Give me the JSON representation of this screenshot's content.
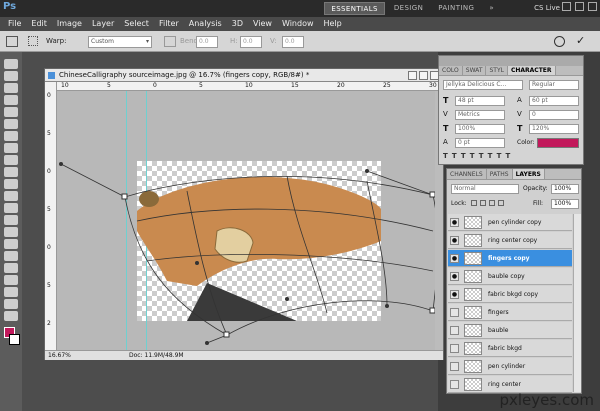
{
  "app": {
    "logo": "Ps"
  },
  "workspace_buttons": [
    {
      "label": "ESSENTIALS",
      "active": true
    },
    {
      "label": "DESIGN",
      "active": false
    },
    {
      "label": "PAINTING",
      "active": false
    },
    {
      "label": "»",
      "active": false
    }
  ],
  "cs_live": "CS Live",
  "menu": [
    "File",
    "Edit",
    "Image",
    "Layer",
    "Select",
    "Filter",
    "Analysis",
    "3D",
    "View",
    "Window",
    "Help"
  ],
  "options": {
    "warp_label": "Warp:",
    "warp_value": "Custom",
    "bend_label": "Bend:",
    "bend_value": "0.0",
    "h_label": "H:",
    "h_value": "0.0",
    "v_label": "V:",
    "v_value": "0.0"
  },
  "document": {
    "title": "ChineseCalligraphy sourceimage.jpg @ 16.7% (fingers copy, RGB/8#) *",
    "zoom": "16.67%",
    "doc_size": "Doc: 11.9M/48.9M",
    "ruler_top": [
      "10",
      "5",
      "0",
      "5",
      "10",
      "15",
      "20",
      "25",
      "30"
    ],
    "ruler_left": [
      "0",
      "5",
      "0",
      "5",
      "0",
      "5",
      "2"
    ]
  },
  "character_panel": {
    "tabs": [
      {
        "label": "COLO",
        "active": false
      },
      {
        "label": "SWAT",
        "active": false
      },
      {
        "label": "STYL",
        "active": false
      },
      {
        "label": "CHARACTER",
        "active": true
      }
    ],
    "font_family": "Jellyka Delicious C...",
    "font_style": "Regular",
    "font_size": "48 pt",
    "leading": "60 pt",
    "kerning": "Metrics",
    "tracking": "0",
    "vscale": "100%",
    "hscale": "120%",
    "baseline": "0 pt",
    "color_label": "Color:",
    "color": "#c2185b"
  },
  "layers_panel": {
    "tabs": [
      {
        "label": "CHANNELS",
        "active": false
      },
      {
        "label": "PATHS",
        "active": false
      },
      {
        "label": "LAYERS",
        "active": true
      }
    ],
    "blend_mode": "Normal",
    "opacity_label": "Opacity:",
    "opacity": "100%",
    "lock_label": "Lock:",
    "fill_label": "Fill:",
    "fill": "100%",
    "layers": [
      {
        "name": "pen cylinder copy",
        "visible": true,
        "selected": false
      },
      {
        "name": "ring center copy",
        "visible": true,
        "selected": false
      },
      {
        "name": "fingers copy",
        "visible": true,
        "selected": true
      },
      {
        "name": "bauble copy",
        "visible": true,
        "selected": false
      },
      {
        "name": "fabric bkgd copy",
        "visible": true,
        "selected": false
      },
      {
        "name": "fingers",
        "visible": false,
        "selected": false
      },
      {
        "name": "bauble",
        "visible": false,
        "selected": false
      },
      {
        "name": "fabric bkgd",
        "visible": false,
        "selected": false
      },
      {
        "name": "pen cylinder",
        "visible": false,
        "selected": false
      },
      {
        "name": "ring center",
        "visible": false,
        "selected": false
      }
    ]
  },
  "watermark": "pxleyes.com",
  "colors": {
    "foreground": "#c2185b",
    "background": "#ffffff",
    "selection": "#3a8fe0"
  }
}
